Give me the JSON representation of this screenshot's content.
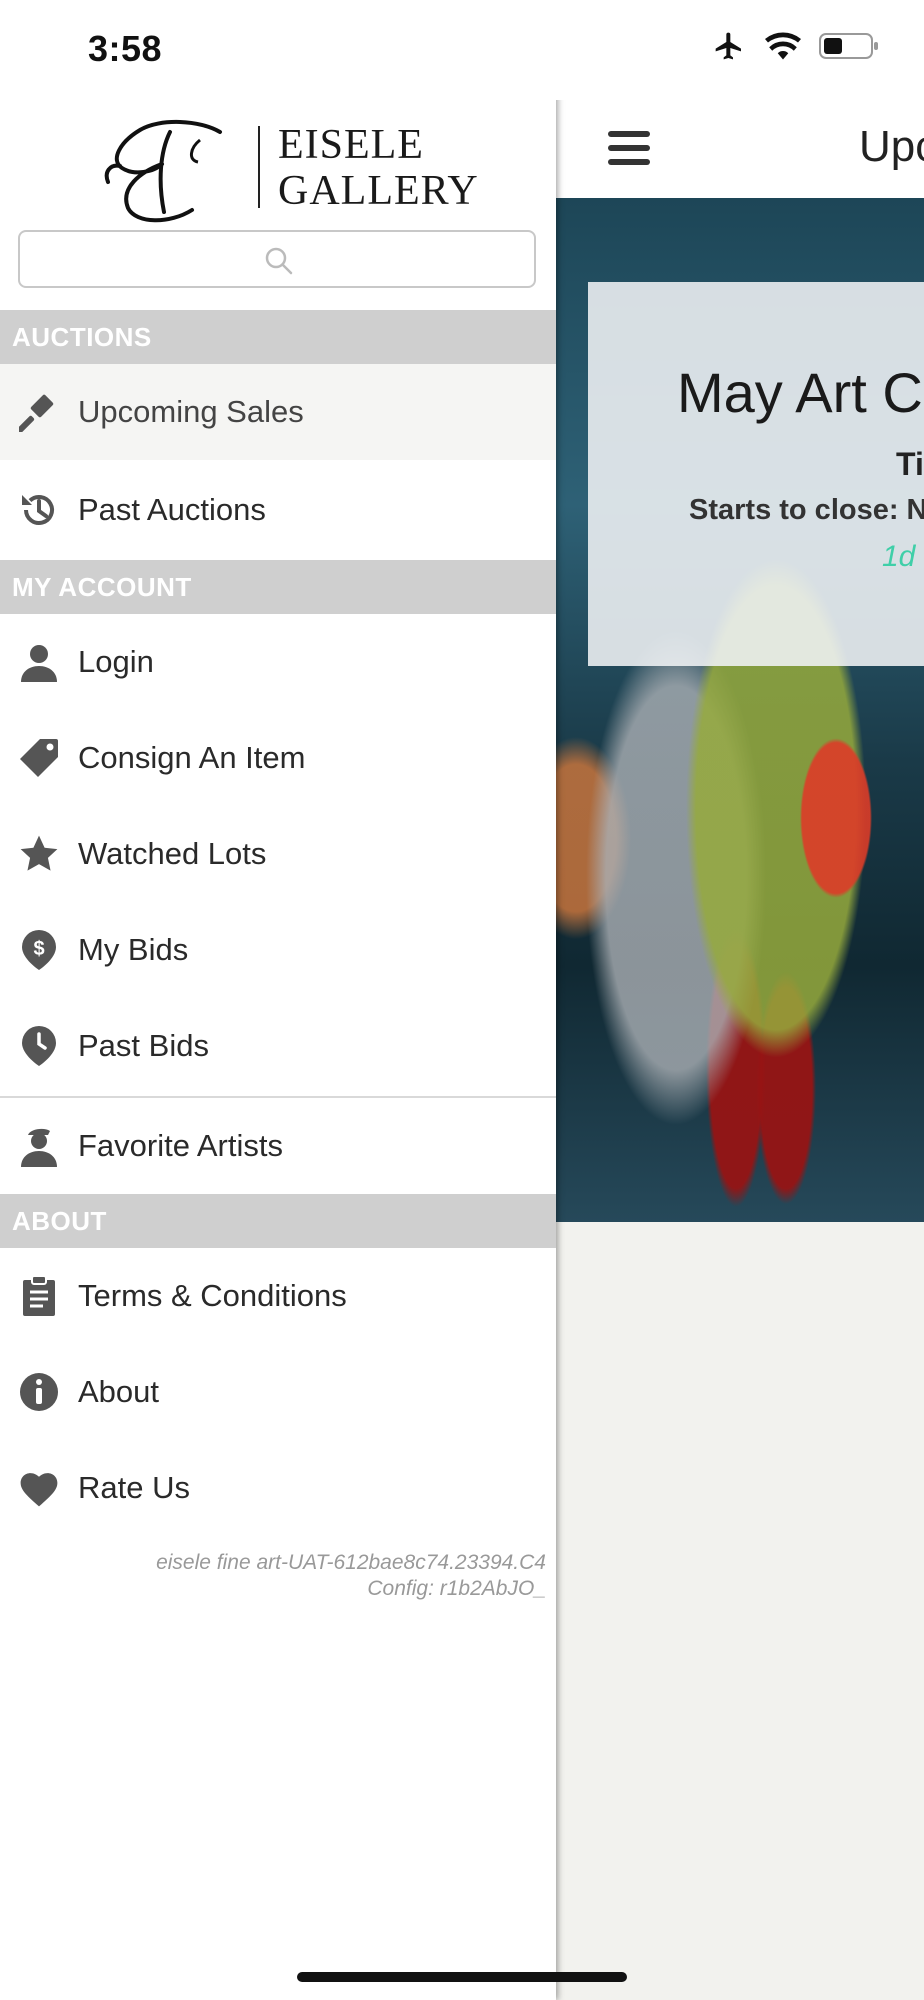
{
  "status_bar": {
    "time": "3:58"
  },
  "logo": {
    "line1": "EISELE",
    "line2": "GALLERY",
    "monogram": "E"
  },
  "search": {
    "placeholder": ""
  },
  "sections": {
    "auctions": "AUCTIONS",
    "my_account": "MY ACCOUNT",
    "about": "ABOUT"
  },
  "menu": {
    "upcoming_sales": "Upcoming Sales",
    "past_auctions": "Past Auctions",
    "login": "Login",
    "consign": "Consign An Item",
    "watched_lots": "Watched Lots",
    "my_bids": "My Bids",
    "past_bids": "Past Bids",
    "favorite_artists": "Favorite Artists",
    "terms": "Terms & Conditions",
    "about": "About",
    "rate_us": "Rate Us"
  },
  "version": {
    "line1": "eisele fine art-UAT-612bae8c74.23394.C4",
    "line2": "Config: r1b2AbJO_"
  },
  "main": {
    "title": "Upc",
    "card_title": "May Art C",
    "card_sub1": "Ti",
    "card_sub2": "Starts to close: N",
    "card_sub3": "1d"
  },
  "colors": {
    "section_header_bg": "#cfcfcf",
    "accent_countdown": "#3fcfa8",
    "icon_gray": "#555555"
  }
}
